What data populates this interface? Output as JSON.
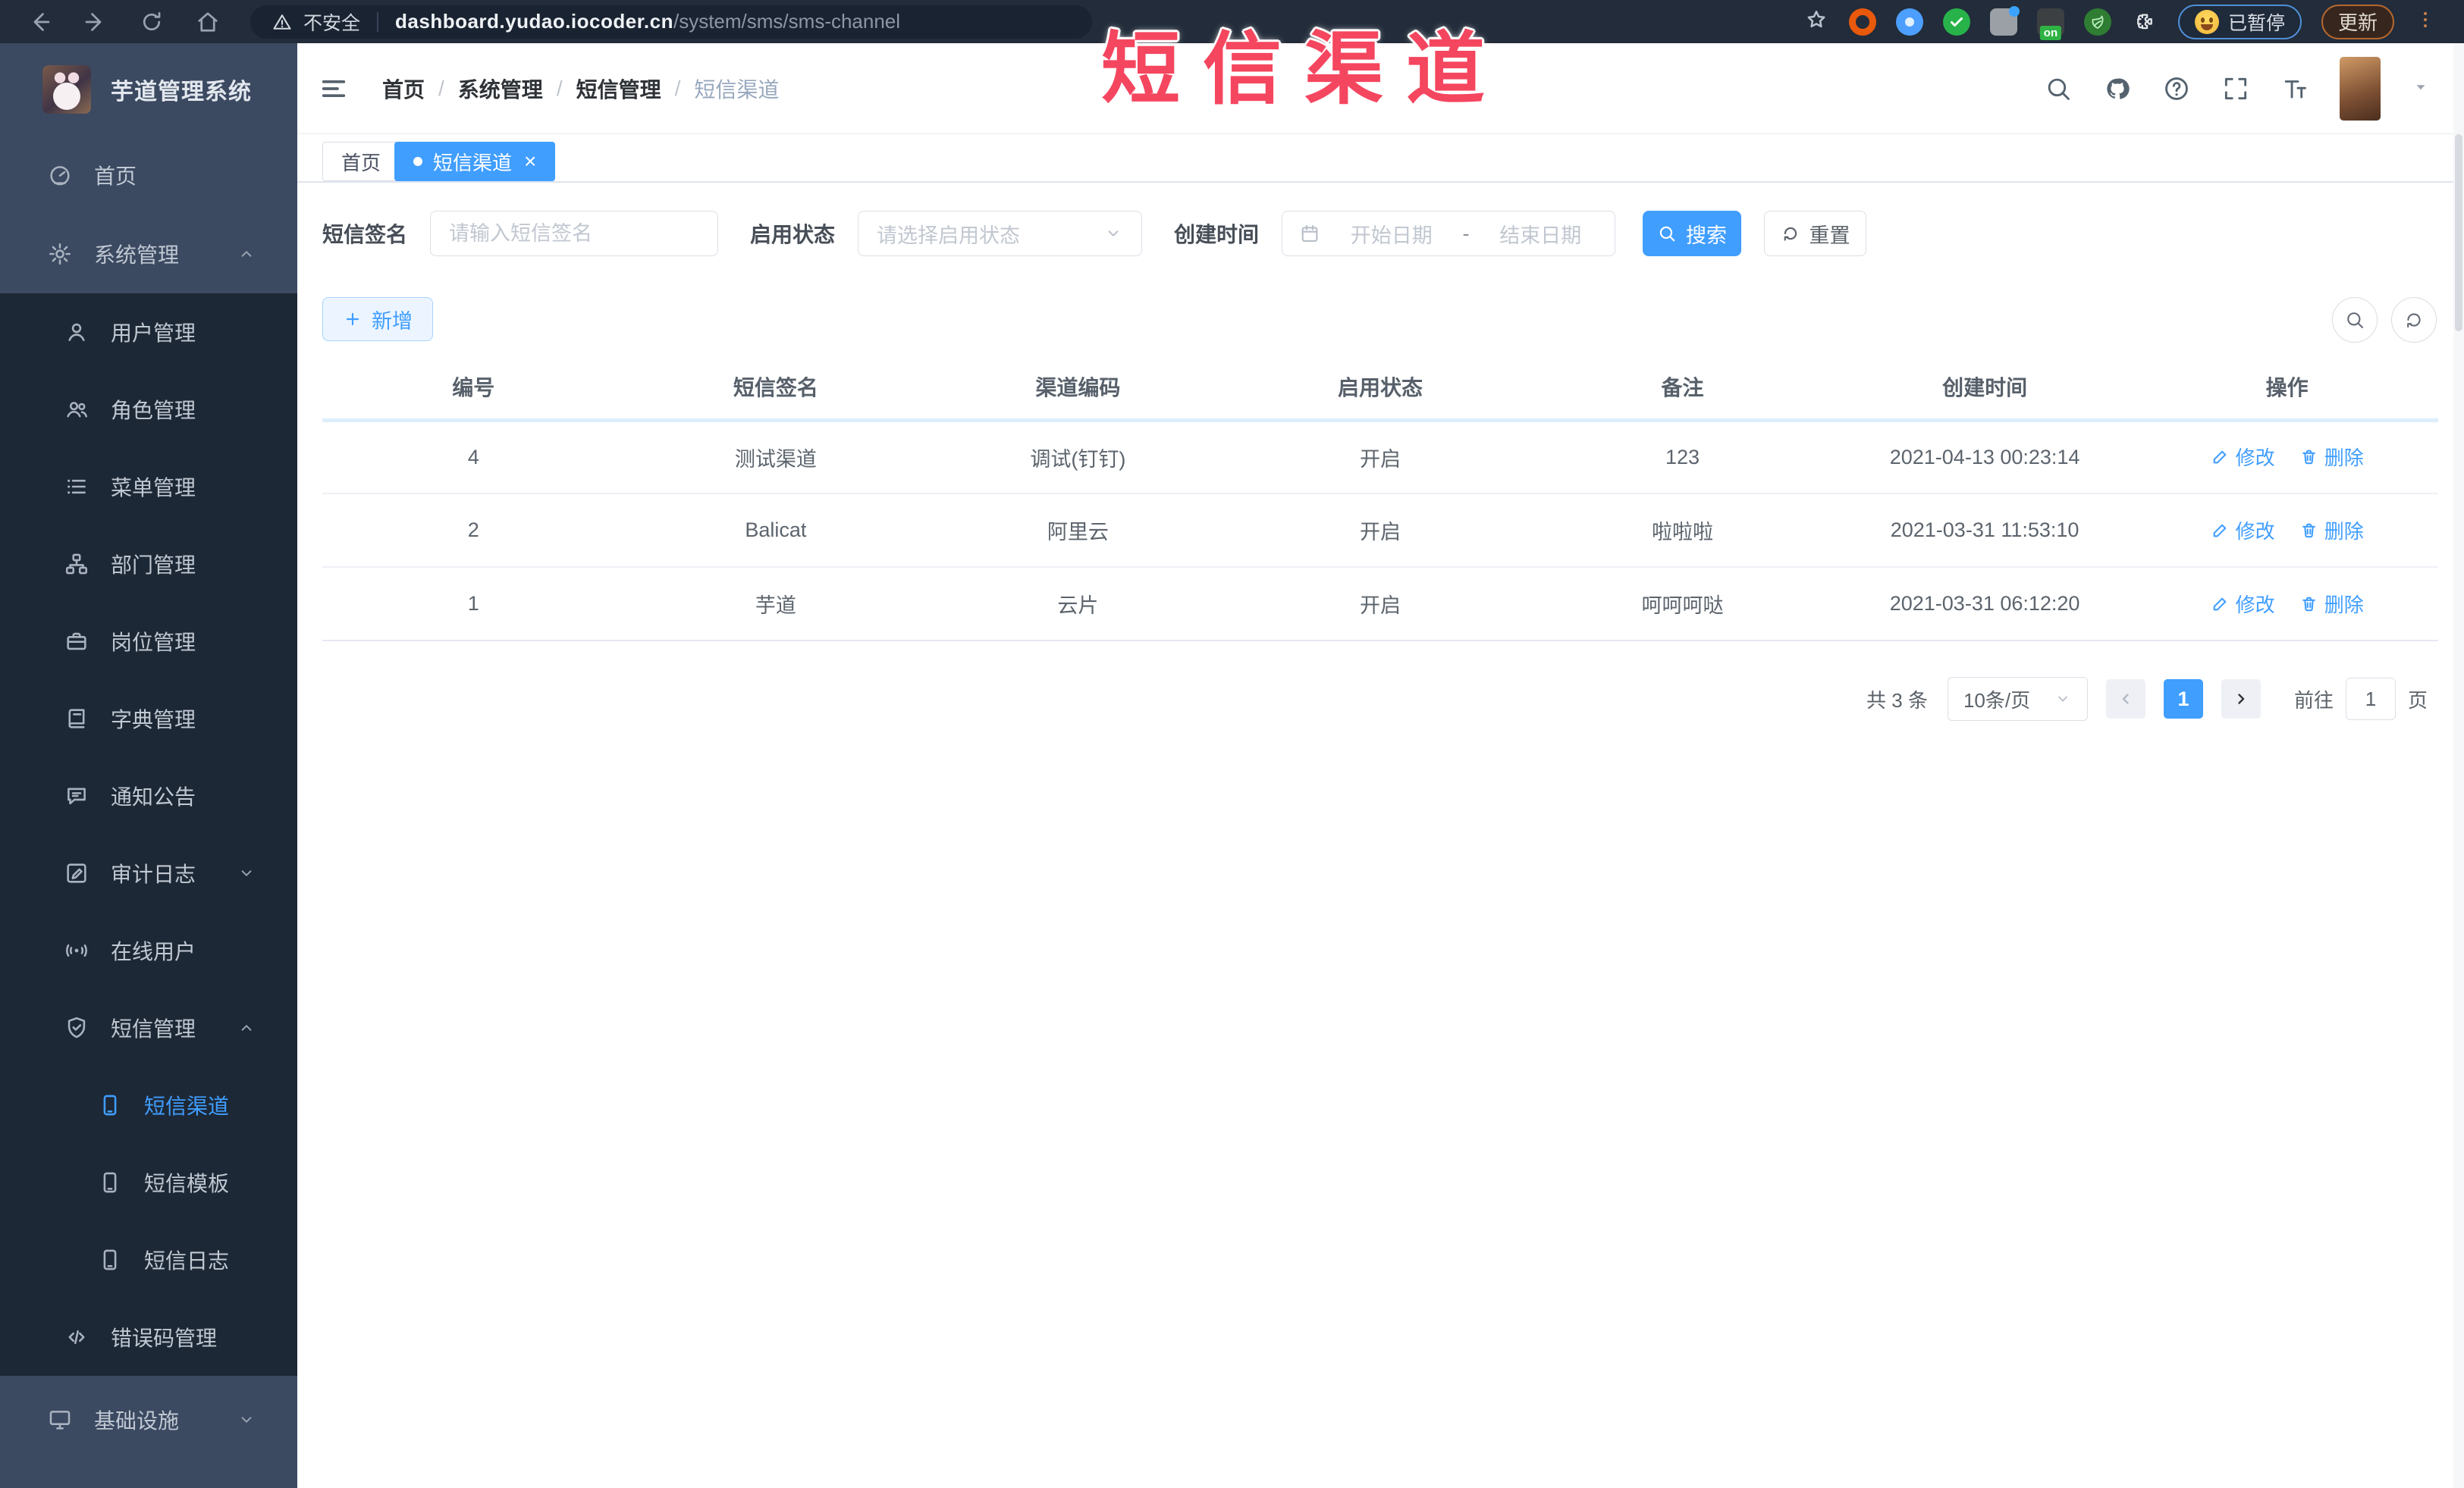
{
  "watermark": "短信渠道",
  "colors": {
    "primary": "#409EFF",
    "watermark_red": "#f5465f",
    "sidebar_dark": "#1d2836",
    "sidebar_light": "#3b4961",
    "active_tab": "#409EFF"
  },
  "browser": {
    "security_label": "不安全",
    "url_host": "dashboard.yudao.iocoder.cn",
    "url_path": "/system/sms/sms-channel",
    "extensions": [
      {
        "icon": "ring-extension-icon",
        "color": "#e8590c"
      },
      {
        "icon": "pin-extension-icon",
        "color": "#4d9fff"
      },
      {
        "icon": "check-extension-icon",
        "color": "#27b24a"
      },
      {
        "icon": "tool-extension-icon",
        "color": "#9aa0a6"
      },
      {
        "icon": "on-badge-extension-icon",
        "color": "#3c4043",
        "badge": "on"
      },
      {
        "icon": "plant-extension-icon",
        "color": "#2e7d32"
      },
      {
        "icon": "puzzle-extension-icon",
        "color": "transparent"
      }
    ],
    "paused_badge": "已暂停",
    "update_button": "更新"
  },
  "sidebar": {
    "app_title": "芋道管理系统",
    "top_items": [
      {
        "label": "首页",
        "icon": "dashboard-icon",
        "level": 1
      },
      {
        "label": "系统管理",
        "icon": "gear-icon",
        "level": 1,
        "chevron": "up"
      }
    ],
    "menu_items": [
      {
        "label": "用户管理",
        "icon": "user-icon",
        "level": 2
      },
      {
        "label": "角色管理",
        "icon": "users-icon",
        "level": 2
      },
      {
        "label": "菜单管理",
        "icon": "menu-list-icon",
        "level": 2
      },
      {
        "label": "部门管理",
        "icon": "org-tree-icon",
        "level": 2
      },
      {
        "label": "岗位管理",
        "icon": "badge-icon",
        "level": 2
      },
      {
        "label": "字典管理",
        "icon": "dictionary-icon",
        "level": 2
      },
      {
        "label": "通知公告",
        "icon": "announcement-icon",
        "level": 2
      },
      {
        "label": "审计日志",
        "icon": "audit-log-icon",
        "level": 2,
        "chevron": "down"
      },
      {
        "label": "在线用户",
        "icon": "online-users-icon",
        "level": 2
      },
      {
        "label": "短信管理",
        "icon": "sms-icon",
        "level": 2,
        "chevron": "up"
      },
      {
        "label": "短信渠道",
        "icon": "phone-icon",
        "level": 3,
        "active": true
      },
      {
        "label": "短信模板",
        "icon": "phone-icon",
        "level": 3
      },
      {
        "label": "短信日志",
        "icon": "phone-icon",
        "level": 3
      },
      {
        "label": "错误码管理",
        "icon": "code-icon",
        "level": 2
      }
    ],
    "bottom_items": [
      {
        "label": "基础设施",
        "icon": "monitor-icon",
        "level": 1,
        "chevron": "down"
      }
    ]
  },
  "header": {
    "breadcrumb": [
      "首页",
      "系统管理",
      "短信管理",
      "短信渠道"
    ],
    "icons": [
      "search-icon",
      "github-icon",
      "question-icon",
      "fullscreen-icon",
      "fontsize-icon"
    ]
  },
  "tabs": [
    {
      "label": "首页",
      "active": false
    },
    {
      "label": "短信渠道",
      "active": true,
      "close": "×"
    }
  ],
  "filters": {
    "sign_label": "短信签名",
    "sign_placeholder": "请输入短信签名",
    "status_label": "启用状态",
    "status_placeholder": "请选择启用状态",
    "time_label": "创建时间",
    "start_placeholder": "开始日期",
    "range_separator": "-",
    "end_placeholder": "结束日期",
    "search_label": "搜索",
    "reset_label": "重置"
  },
  "toolbar": {
    "add_label": "新增"
  },
  "table": {
    "headers": [
      "编号",
      "短信签名",
      "渠道编码",
      "启用状态",
      "备注",
      "创建时间",
      "操作"
    ],
    "rows": [
      [
        "4",
        "测试渠道",
        "调试(钉钉)",
        "开启",
        "123",
        "2021-04-13 00:23:14"
      ],
      [
        "2",
        "Balicat",
        "阿里云",
        "开启",
        "啦啦啦",
        "2021-03-31 11:53:10"
      ],
      [
        "1",
        "芋道",
        "云片",
        "开启",
        "呵呵呵哒",
        "2021-03-31 06:12:20"
      ]
    ],
    "op_edit": "修改",
    "op_delete": "删除"
  },
  "pagination": {
    "total": "共 3 条",
    "page_size": "10条/页",
    "current_page": "1",
    "goto_label": "前往",
    "goto_value": "1",
    "unit_label": "页"
  }
}
